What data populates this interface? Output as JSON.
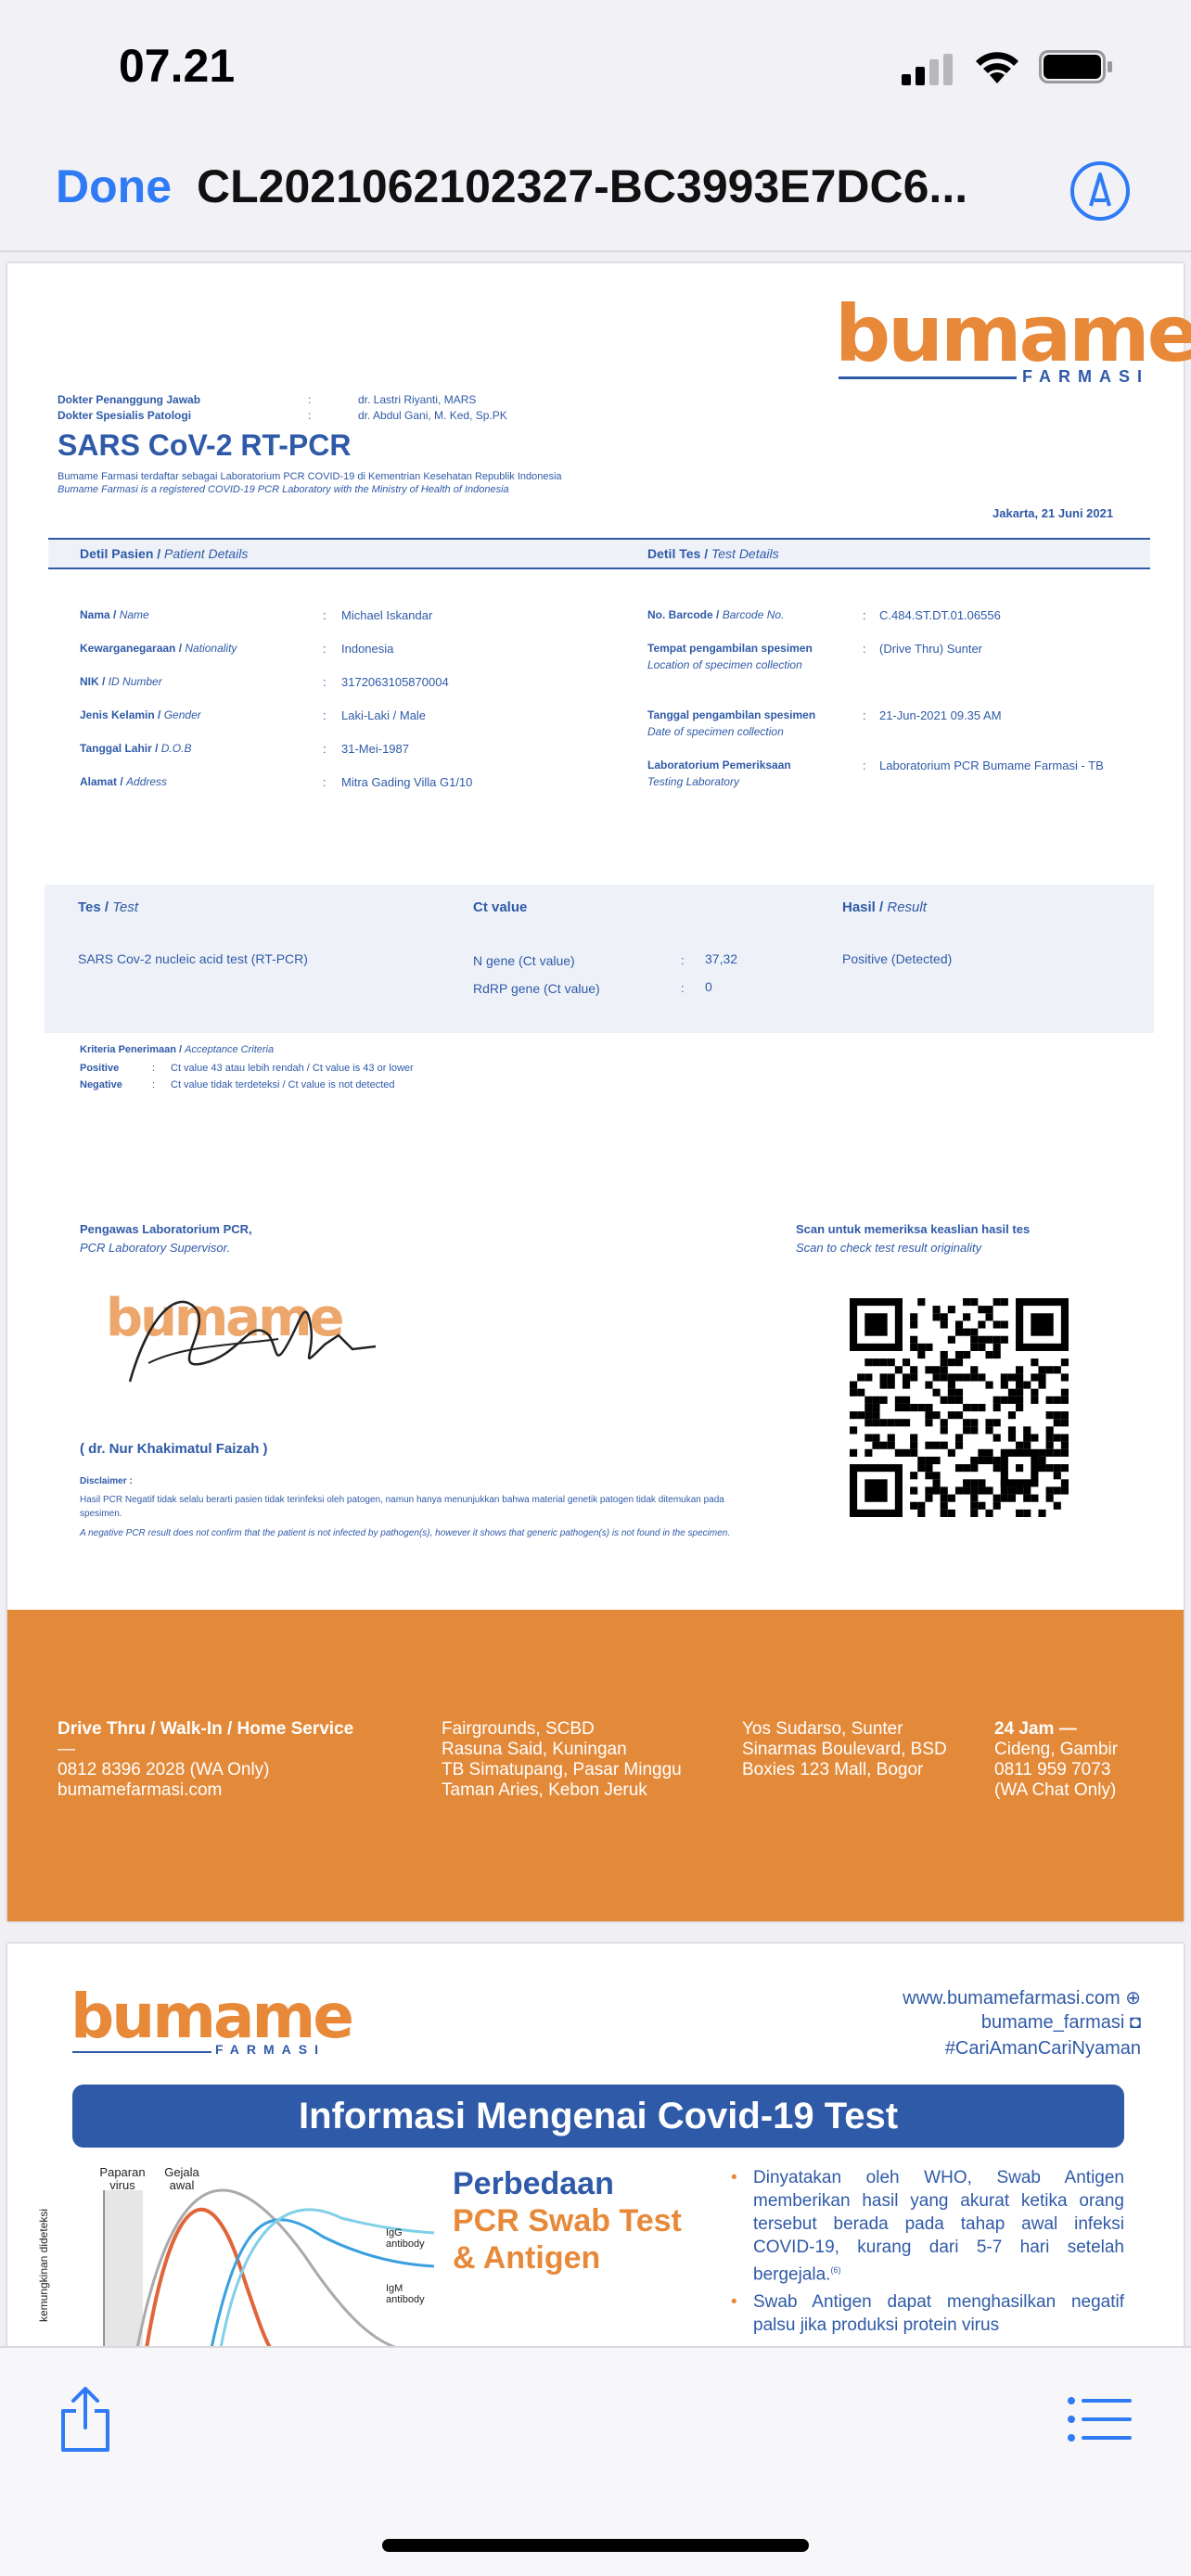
{
  "status": {
    "time": "07.21"
  },
  "nav": {
    "done": "Done",
    "title": "CL2021062102327-BC3993E7DC6..."
  },
  "report": {
    "logo_b": "bu",
    "logo_m": "mame",
    "logo_sub": "FARMASI",
    "doctor1_label": "Dokter Penanggung Jawab",
    "doctor1_value": "dr. Lastri Riyanti, MARS",
    "doctor2_label": "Dokter Spesialis Patologi",
    "doctor2_value": "dr. Abdul Gani, M. Ked, Sp.PK",
    "title": "SARS CoV-2 RT-PCR",
    "reg_id": "Bumame Farmasi terdaftar sebagai Laboratorium PCR COVID-19 di Kementrian Kesehatan Republik Indonesia",
    "reg_en": "Bumame Farmasi is a registered COVID-19 PCR Laboratory with the Ministry of Health of Indonesia",
    "date": "Jakarta, 21 Juni 2021",
    "patient_head": "Detil Pasien /",
    "patient_head_en": "Patient Details",
    "test_head": "Detil Tes /",
    "test_head_en": "Test Details",
    "patient": [
      {
        "label": "Nama /",
        "label_en": "Name",
        "value": "Michael Iskandar"
      },
      {
        "label": "Kewarganegaraan /",
        "label_en": "Nationality",
        "value": "Indonesia"
      },
      {
        "label": "NIK /",
        "label_en": "ID Number",
        "value": "3172063105870004"
      },
      {
        "label": "Jenis Kelamin /",
        "label_en": "Gender",
        "value": "Laki-Laki / Male"
      },
      {
        "label": "Tanggal Lahir /",
        "label_en": "D.O.B",
        "value": "31-Mei-1987"
      },
      {
        "label": "Alamat /",
        "label_en": "Address",
        "value": "Mitra Gading Villa G1/10"
      }
    ],
    "test": [
      {
        "label": "No. Barcode /",
        "label_en": "Barcode No.",
        "sub": "",
        "value": "C.484.ST.DT.01.06556"
      },
      {
        "label": "Tempat pengambilan spesimen",
        "label_en": "",
        "sub": "Location of specimen collection",
        "value": "(Drive Thru) Sunter"
      },
      {
        "label": "Tanggal pengambilan spesimen",
        "label_en": "",
        "sub": "Date of specimen collection",
        "value": "21-Jun-2021 09.35 AM"
      },
      {
        "label": "Laboratorium Pemeriksaan",
        "label_en": "",
        "sub": "Testing Laboratory",
        "value": "Laboratorium PCR Bumame Farmasi - TB"
      }
    ],
    "results": {
      "col_test": "Tes /",
      "col_test_en": "Test",
      "col_ct": "Ct value",
      "col_result": "Hasil /",
      "col_result_en": "Result",
      "test_name": "SARS Cov-2 nucleic acid test (RT-PCR)",
      "n_gene": "N gene (Ct value)",
      "n_value": "37,32",
      "rdrp_gene": "RdRP gene (Ct value)",
      "rdrp_value": "0",
      "result": "Positive (Detected)"
    },
    "criteria_head": "Kriteria Penerimaan /",
    "criteria_head_en": "Acceptance Criteria",
    "criteria": [
      {
        "label": "Positive",
        "text": "Ct value 43 atau lebih rendah / Ct value is 43 or lower"
      },
      {
        "label": "Negative",
        "text": "Ct value tidak terdeteksi / Ct value is not detected"
      }
    ],
    "supervisor_id": "Pengawas Laboratorium PCR,",
    "supervisor_en": "PCR Laboratory Supervisor.",
    "supervisor_name": "( dr. Nur Khakimatul Faizah )",
    "scan_id": "Scan untuk memeriksa keaslian hasil tes",
    "scan_en": "Scan to check test result originality",
    "disclaimer_head": "Disclaimer :",
    "disclaimer_id": "Hasil PCR Negatif tidak selalu berarti pasien tidak terinfeksi oleh patogen, namun hanya menunjukkan bahwa material genetik patogen tidak ditemukan pada spesimen.",
    "disclaimer_en": "A negative PCR result does not confirm that the patient is not infected by pathogen(s), however it shows that generic pathogen(s) is not found in the specimen."
  },
  "footer": {
    "col1": [
      "Drive Thru / Walk-In / Home Service",
      "—",
      "0812 8396 2028 (WA Only)",
      "bumamefarmasi.com"
    ],
    "col2": [
      "Fairgrounds, SCBD",
      "Rasuna Said, Kuningan",
      "TB Simatupang, Pasar Minggu",
      "Taman Aries, Kebon Jeruk"
    ],
    "col3": [
      "Yos Sudarso, Sunter",
      "Sinarmas Boulevard, BSD",
      "Boxies 123 Mall, Bogor"
    ],
    "col4": [
      "24 Jam —",
      "Cideng, Gambir",
      "0811 959 7073",
      "(WA Chat Only)"
    ],
    "color": "#e38a3a"
  },
  "info": {
    "web": "www.bumamefarmasi.com",
    "ig": "bumame_farmasi",
    "hashtag": "#CariAmanCariNyaman",
    "banner": "Informasi Mengenai Covid-19 Test",
    "diff1": "Perbedaan",
    "diff2": "PCR Swab Test",
    "diff3": "& Antigen",
    "chart_label1": "Paparan virus",
    "chart_label2": "Gejala awal",
    "chart_y": "kemungkinan dideteksi",
    "igg": "IgG antibody",
    "igm": "IgM antibody",
    "bullet1": "Dinyatakan oleh WHO, Swab Antigen memberikan hasil yang akurat ketika orang tersebut berada pada tahap awal infeksi COVID-19, kurang dari 5-7 hari setelah bergejala.",
    "bullet1_ref": "(6)",
    "bullet2": "Swab Antigen dapat menghasilkan negatif palsu jika produksi protein virus"
  }
}
